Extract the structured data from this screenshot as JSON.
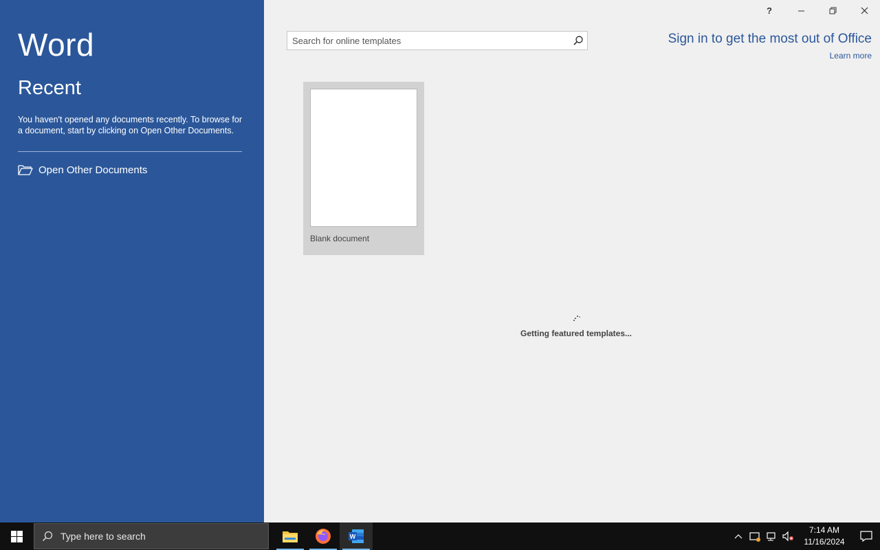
{
  "app": {
    "title": "Word"
  },
  "recent": {
    "title": "Recent",
    "message": "You haven't opened any documents recently. To browse for a document, start by clicking on Open Other Documents.",
    "open_other_label": "Open Other Documents"
  },
  "window_controls": {
    "help": "?"
  },
  "search": {
    "placeholder": "Search for online templates",
    "value": ""
  },
  "signin": {
    "title": "Sign in to get the most out of Office",
    "learn_more": "Learn more"
  },
  "templates": [
    {
      "label": "Blank document"
    }
  ],
  "loading": {
    "text": "Getting featured templates..."
  },
  "taskbar": {
    "search_placeholder": "Type here to search",
    "apps": [
      "file-explorer-icon",
      "firefox-icon",
      "word-icon"
    ],
    "time": "7:14 AM",
    "date": "11/16/2024"
  },
  "colors": {
    "accent": "#2b579a",
    "background": "#f0f0f0",
    "taskbar": "#101010"
  }
}
